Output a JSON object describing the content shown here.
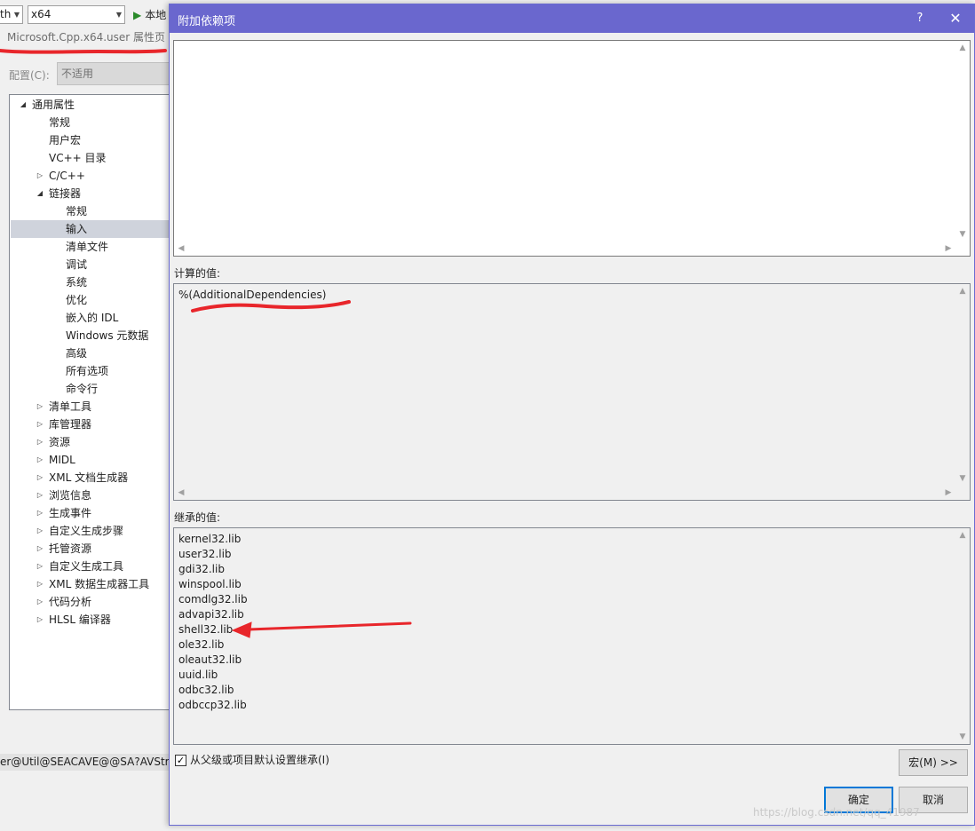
{
  "toolbar": {
    "platform_partial": "th",
    "platform_value": "x64",
    "run_label": "本地"
  },
  "property_page": {
    "title": "Microsoft.Cpp.x64.user 属性页",
    "config_label": "配置(C):",
    "config_value": "不适用",
    "tree": [
      {
        "label": "通用属性",
        "level": 0,
        "state": "expanded"
      },
      {
        "label": "常规",
        "level": 1,
        "state": "leaf"
      },
      {
        "label": "用户宏",
        "level": 1,
        "state": "leaf"
      },
      {
        "label": "VC++ 目录",
        "level": 1,
        "state": "leaf"
      },
      {
        "label": "C/C++",
        "level": 1,
        "state": "collapsed"
      },
      {
        "label": "链接器",
        "level": 1,
        "state": "expanded"
      },
      {
        "label": "常规",
        "level": 2,
        "state": "leaf"
      },
      {
        "label": "输入",
        "level": 2,
        "state": "leaf",
        "selected": true
      },
      {
        "label": "清单文件",
        "level": 2,
        "state": "leaf"
      },
      {
        "label": "调试",
        "level": 2,
        "state": "leaf"
      },
      {
        "label": "系统",
        "level": 2,
        "state": "leaf"
      },
      {
        "label": "优化",
        "level": 2,
        "state": "leaf"
      },
      {
        "label": "嵌入的 IDL",
        "level": 2,
        "state": "leaf"
      },
      {
        "label": "Windows 元数据",
        "level": 2,
        "state": "leaf"
      },
      {
        "label": "高级",
        "level": 2,
        "state": "leaf"
      },
      {
        "label": "所有选项",
        "level": 2,
        "state": "leaf"
      },
      {
        "label": "命令行",
        "level": 2,
        "state": "leaf"
      },
      {
        "label": "清单工具",
        "level": 1,
        "state": "collapsed"
      },
      {
        "label": "库管理器",
        "level": 1,
        "state": "collapsed"
      },
      {
        "label": "资源",
        "level": 1,
        "state": "collapsed"
      },
      {
        "label": "MIDL",
        "level": 1,
        "state": "collapsed"
      },
      {
        "label": "XML 文档生成器",
        "level": 1,
        "state": "collapsed"
      },
      {
        "label": "浏览信息",
        "level": 1,
        "state": "collapsed"
      },
      {
        "label": "生成事件",
        "level": 1,
        "state": "collapsed"
      },
      {
        "label": "自定义生成步骤",
        "level": 1,
        "state": "collapsed"
      },
      {
        "label": "托管资源",
        "level": 1,
        "state": "collapsed"
      },
      {
        "label": "自定义生成工具",
        "level": 1,
        "state": "collapsed"
      },
      {
        "label": "XML 数据生成器工具",
        "level": 1,
        "state": "collapsed"
      },
      {
        "label": "代码分析",
        "level": 1,
        "state": "collapsed"
      },
      {
        "label": "HLSL 编译器",
        "level": 1,
        "state": "collapsed"
      }
    ],
    "status_text": "er@Util@SEACAVE@@SA?AVStrin"
  },
  "dialog": {
    "title": "附加依赖项",
    "help_label": "?",
    "close_label": "✕",
    "input_value": "",
    "computed_label": "计算的值:",
    "computed_value": "%(AdditionalDependencies)",
    "inherited_label": "继承的值:",
    "inherited_values": [
      "kernel32.lib",
      "user32.lib",
      "gdi32.lib",
      "winspool.lib",
      "comdlg32.lib",
      "advapi32.lib",
      "shell32.lib",
      "ole32.lib",
      "oleaut32.lib",
      "uuid.lib",
      "odbc32.lib",
      "odbccp32.lib"
    ],
    "inherit_checkbox_label": "从父级或项目默认设置继承(I)",
    "inherit_checked": true,
    "macro_button": "宏(M) >>",
    "ok_button": "确定",
    "cancel_button": "取消"
  },
  "watermark": "https://blog.csdn.net/qq_41987",
  "colors": {
    "titlebar": "#6a67ce",
    "annotation": "#e8262b",
    "selection": "#cfd3dc"
  }
}
